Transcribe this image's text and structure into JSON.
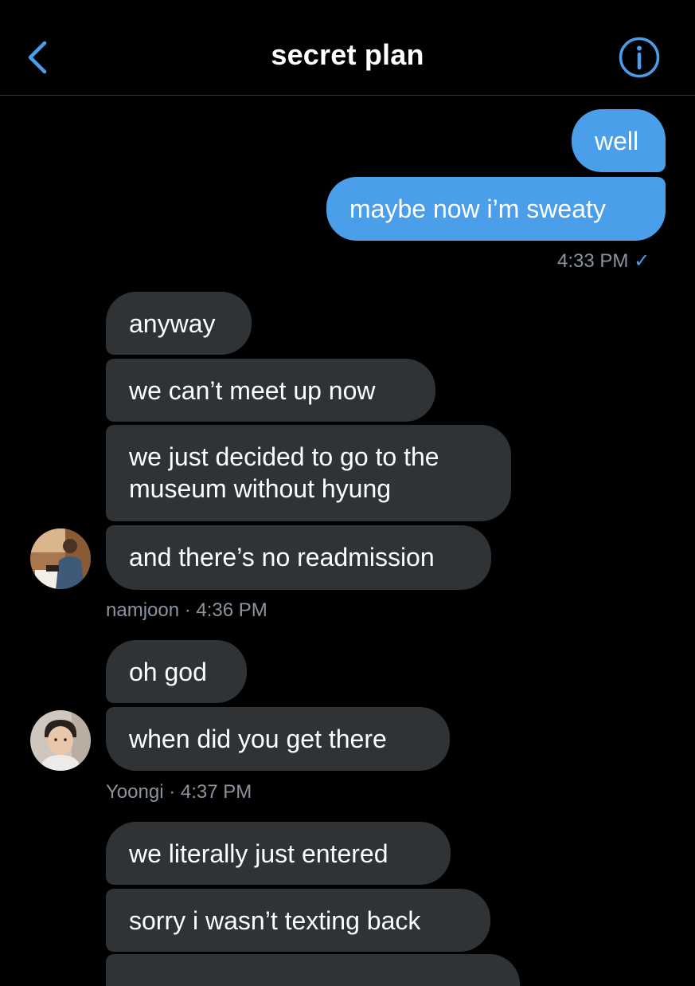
{
  "header": {
    "title": "secret plan"
  },
  "colors": {
    "accent": "#4a9eea",
    "incoming_bubble": "#2f3336",
    "background": "#000000",
    "meta_text": "#8b949e"
  },
  "icons": {
    "back": "chevron-left-icon",
    "info": "info-circle-icon",
    "read_receipt": "checkmark-icon"
  },
  "messages": {
    "outgoing": [
      {
        "text": "well"
      },
      {
        "text": "maybe now i’m sweaty"
      }
    ],
    "outgoing_time": "4:33 PM",
    "outgoing_check": "✓",
    "namjoon": [
      {
        "text": "anyway"
      },
      {
        "text": "we can’t meet up now"
      },
      {
        "text": "we just decided to go to the\nmuseum without hyung"
      },
      {
        "text": "and there’s no readmission"
      }
    ],
    "namjoon_meta": "namjoon · 4:36 PM",
    "yoongi": [
      {
        "text": "oh god"
      },
      {
        "text": "when did you get there"
      }
    ],
    "yoongi_meta": "Yoongi · 4:37 PM",
    "next": [
      {
        "text": "we literally just entered"
      },
      {
        "text": "sorry i wasn’t texting back"
      }
    ]
  }
}
